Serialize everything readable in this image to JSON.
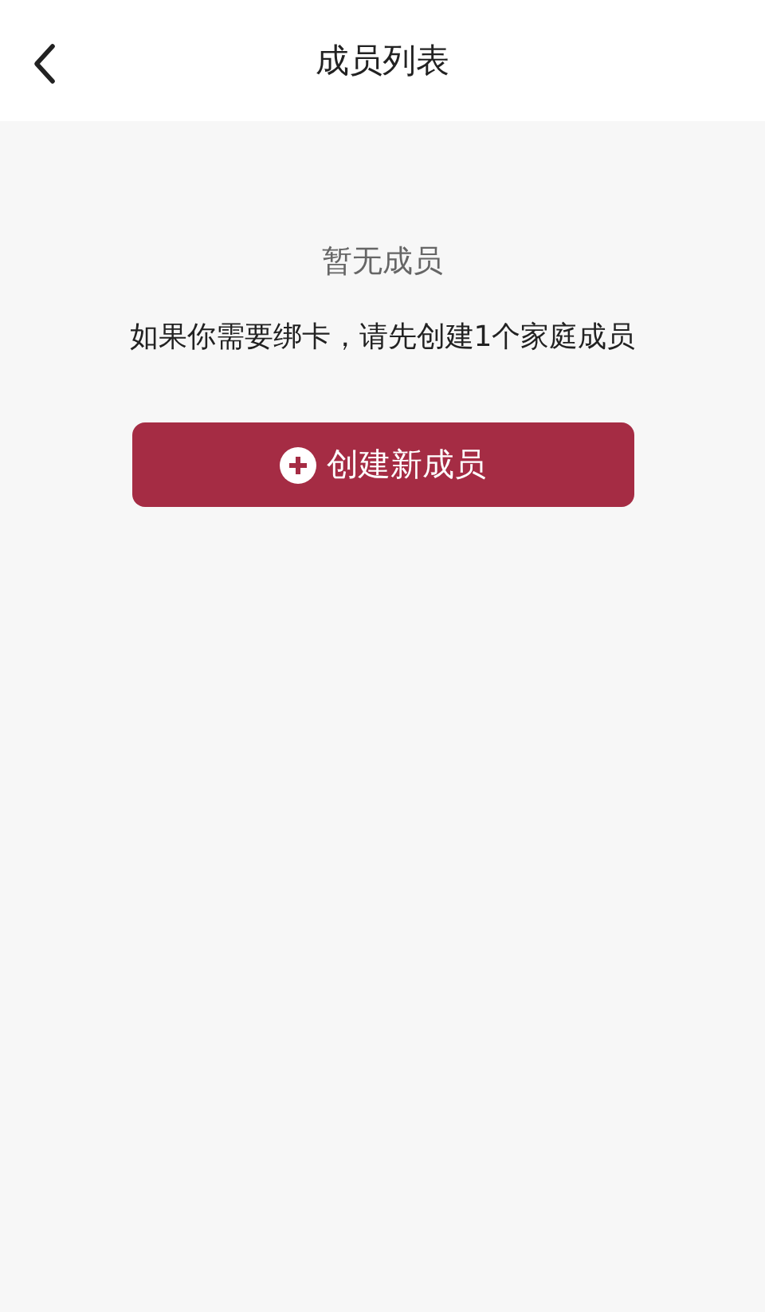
{
  "header": {
    "title": "成员列表"
  },
  "empty_state": {
    "title": "暂无成员",
    "message": "如果你需要绑卡，请先创建1个家庭成员"
  },
  "create_button": {
    "label": "创建新成员"
  }
}
